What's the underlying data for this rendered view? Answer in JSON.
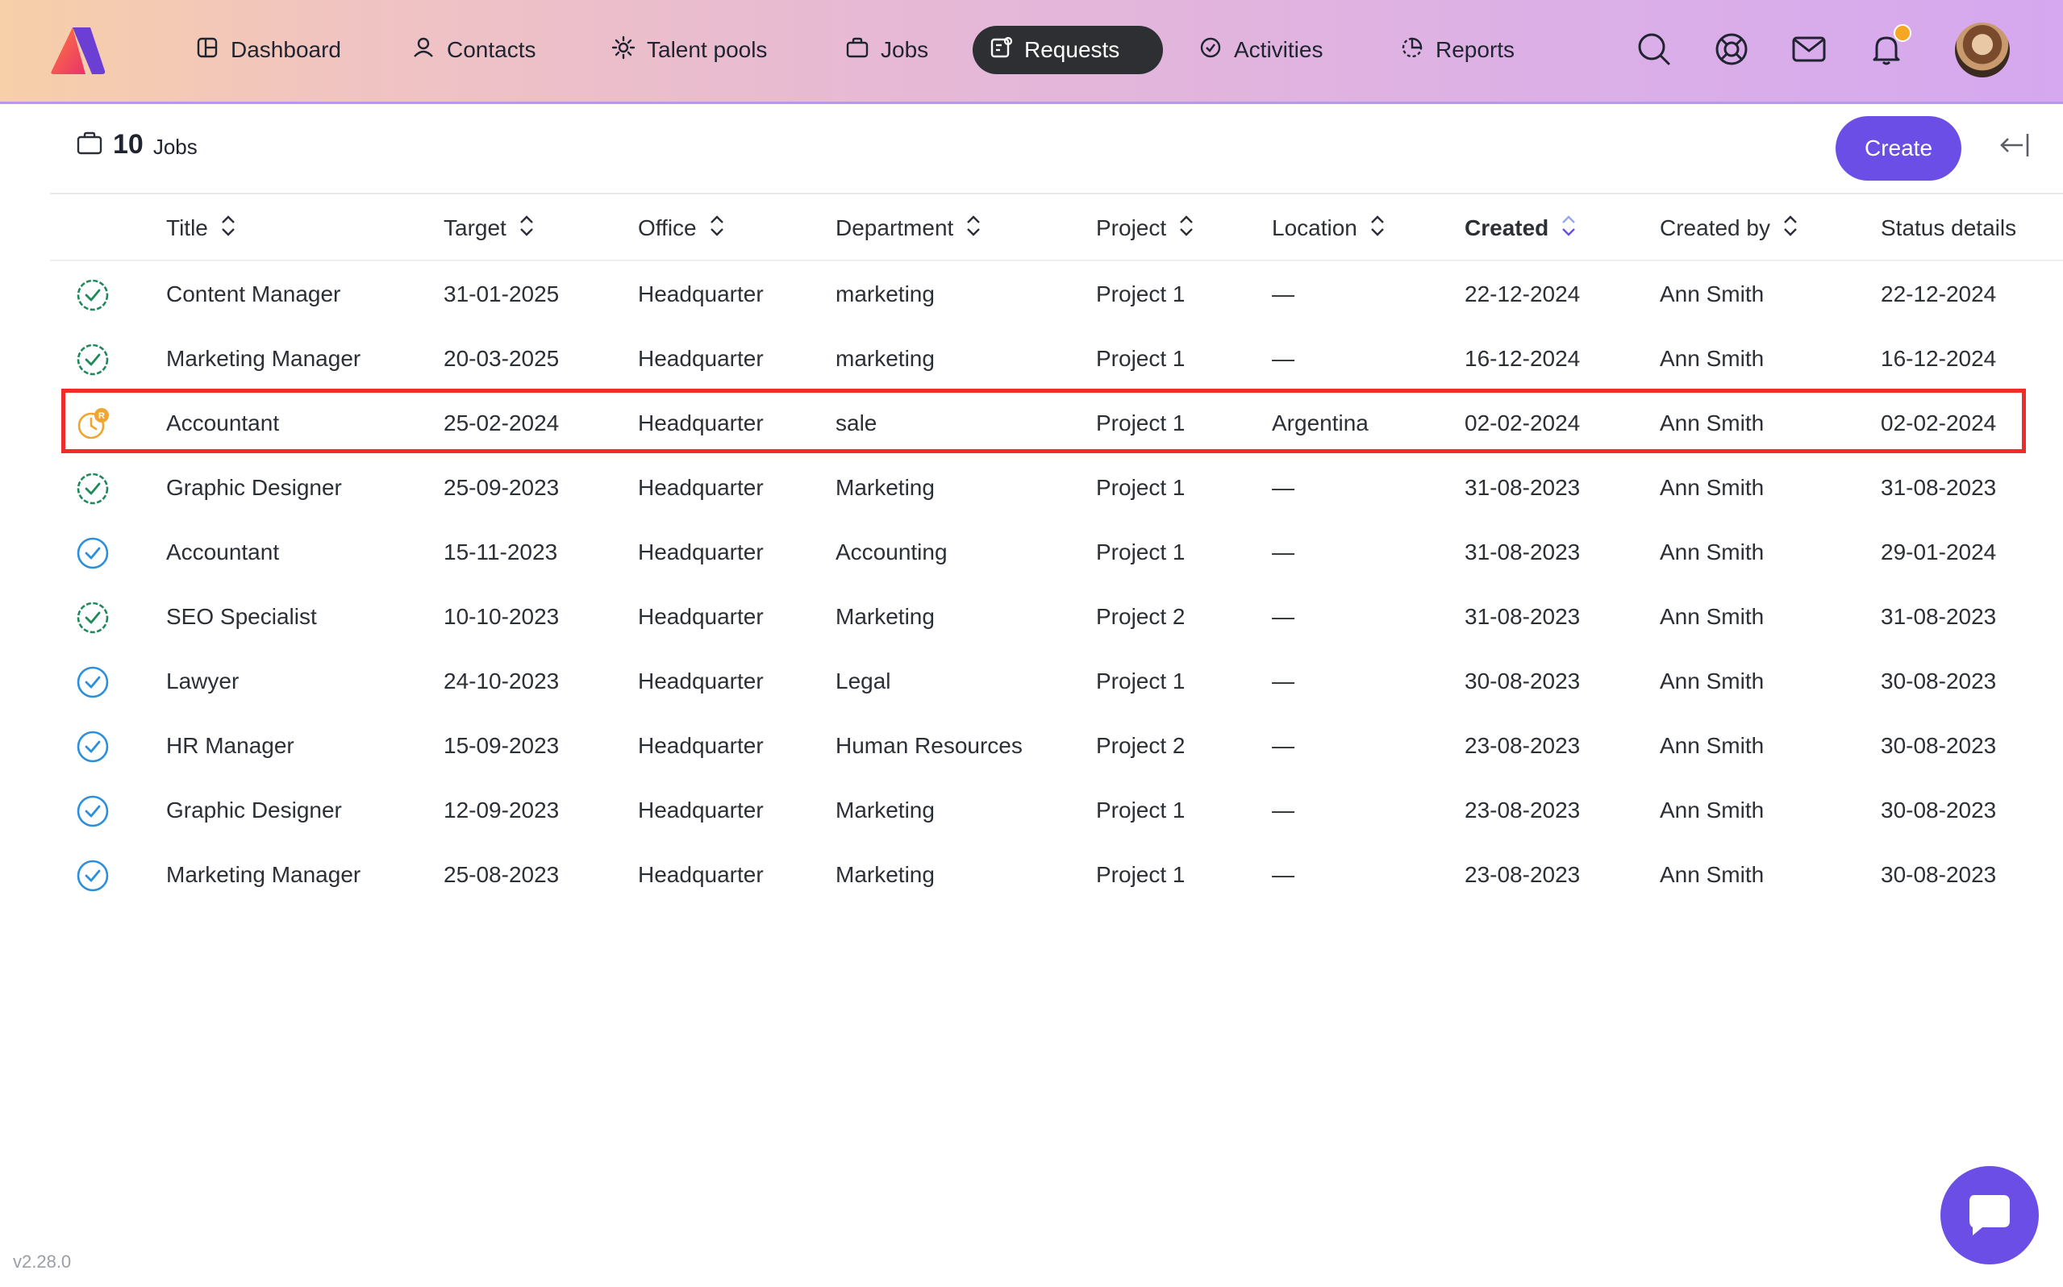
{
  "nav": {
    "items": [
      {
        "label": "Dashboard",
        "icon": "dashboard-icon"
      },
      {
        "label": "Contacts",
        "icon": "contacts-icon"
      },
      {
        "label": "Talent pools",
        "icon": "talent-pools-icon"
      },
      {
        "label": "Jobs",
        "icon": "briefcase-icon"
      },
      {
        "label": "Requests",
        "icon": "requests-icon",
        "active": true
      },
      {
        "label": "Activities",
        "icon": "activities-icon"
      },
      {
        "label": "Reports",
        "icon": "reports-icon"
      }
    ],
    "right_icons": [
      "search-icon",
      "help-lifebuoy-icon",
      "mail-icon",
      "bell-icon"
    ],
    "notification_dot_color": "#f5a623"
  },
  "toolbar": {
    "count": "10",
    "count_label": "Jobs",
    "create_label": "Create"
  },
  "table": {
    "columns": [
      "Title",
      "Target",
      "Office",
      "Department",
      "Project",
      "Location",
      "Created",
      "Created by",
      "Status details"
    ],
    "rows": [
      {
        "status": "approved-green",
        "title": "Content Manager",
        "target": "31-01-2025",
        "office": "Headquarter",
        "department": "marketing",
        "project": "Project 1",
        "location": "—",
        "created": "22-12-2024",
        "created_by": "Ann Smith",
        "status_details": "22-12-2024"
      },
      {
        "status": "approved-green",
        "title": "Marketing Manager",
        "target": "20-03-2025",
        "office": "Headquarter",
        "department": "marketing",
        "project": "Project 1",
        "location": "—",
        "created": "16-12-2024",
        "created_by": "Ann Smith",
        "status_details": "16-12-2024"
      },
      {
        "status": "pending-orange",
        "title": "Accountant",
        "target": "25-02-2024",
        "office": "Headquarter",
        "department": "sale",
        "project": "Project 1",
        "location": "Argentina",
        "created": "02-02-2024",
        "created_by": "Ann Smith",
        "status_details": "02-02-2024"
      },
      {
        "status": "approved-green",
        "title": "Graphic Designer",
        "target": "25-09-2023",
        "office": "Headquarter",
        "department": "Marketing",
        "project": "Project 1",
        "location": "—",
        "created": "31-08-2023",
        "created_by": "Ann Smith",
        "status_details": "31-08-2023"
      },
      {
        "status": "done-blue",
        "title": "Accountant",
        "target": "15-11-2023",
        "office": "Headquarter",
        "department": "Accounting",
        "project": "Project 1",
        "location": "—",
        "created": "31-08-2023",
        "created_by": "Ann Smith",
        "status_details": "29-01-2024"
      },
      {
        "status": "approved-green",
        "title": "SEO Specialist",
        "target": "10-10-2023",
        "office": "Headquarter",
        "department": "Marketing",
        "project": "Project 2",
        "location": "—",
        "created": "31-08-2023",
        "created_by": "Ann Smith",
        "status_details": "31-08-2023"
      },
      {
        "status": "done-blue",
        "title": "Lawyer",
        "target": "24-10-2023",
        "office": "Headquarter",
        "department": "Legal",
        "project": "Project 1",
        "location": "—",
        "created": "30-08-2023",
        "created_by": "Ann Smith",
        "status_details": "30-08-2023"
      },
      {
        "status": "done-blue",
        "title": "HR Manager",
        "target": "15-09-2023",
        "office": "Headquarter",
        "department": "Human Resources",
        "project": "Project 2",
        "location": "—",
        "created": "23-08-2023",
        "created_by": "Ann Smith",
        "status_details": "30-08-2023"
      },
      {
        "status": "done-blue",
        "title": "Graphic Designer",
        "target": "12-09-2023",
        "office": "Headquarter",
        "department": "Marketing",
        "project": "Project 1",
        "location": "—",
        "created": "23-08-2023",
        "created_by": "Ann Smith",
        "status_details": "30-08-2023"
      },
      {
        "status": "done-blue",
        "title": "Marketing Manager",
        "target": "25-08-2023",
        "office": "Headquarter",
        "department": "Marketing",
        "project": "Project 1",
        "location": "—",
        "created": "23-08-2023",
        "created_by": "Ann Smith",
        "status_details": "30-08-2023"
      }
    ],
    "highlighted_row": 2
  },
  "status_colors": {
    "approved-green": "#1e8a5a",
    "done-blue": "#2d8fdc",
    "pending-orange": "#f0a530"
  },
  "pending_badge": "R",
  "brand_color": "#6b4ee6",
  "version": "v2.28.0"
}
